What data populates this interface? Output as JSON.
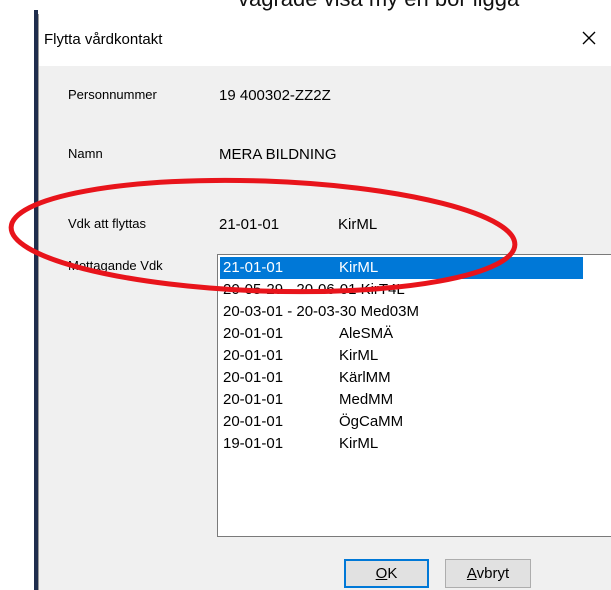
{
  "background": {
    "partial_text": "vägrade visa my en bör ligga"
  },
  "dialog": {
    "title": "Flytta vårdkontakt",
    "close_glyph": "✕"
  },
  "fields": {
    "personnummer_label": "Personnummer",
    "personnummer_value": "19 400302-ZZ2Z",
    "namn_label": "Namn",
    "namn_value": "MERA BILDNING",
    "vdk_label": "Vdk att flyttas",
    "vdk_date": "21-01-01",
    "vdk_code": "KirML",
    "mottagande_label": "Mottagande Vdk"
  },
  "list": {
    "selected_index": 0,
    "items": [
      {
        "date": "21-01-01",
        "code": "KirML"
      },
      {
        "date": "20-05-29 - 20-06-01 KirT4L",
        "code": ""
      },
      {
        "date": "20-03-01 - 20-03-30 Med03M",
        "code": ""
      },
      {
        "date": "20-01-01",
        "code": "AleSMÄ"
      },
      {
        "date": "20-01-01",
        "code": "KirML"
      },
      {
        "date": "20-01-01",
        "code": "KärlMM"
      },
      {
        "date": "20-01-01",
        "code": "MedMM"
      },
      {
        "date": "20-01-01",
        "code": "ÖgCaMM"
      },
      {
        "date": "19-01-01",
        "code": "KirML"
      }
    ]
  },
  "buttons": {
    "ok_label": "OK",
    "ok_mnemonic": "O",
    "cancel_label": "Avbryt",
    "cancel_mnemonic": "A"
  },
  "colors": {
    "selection": "#0078d7",
    "annotation_ellipse": "#e8141b",
    "client_bg": "#f0f0f0"
  }
}
